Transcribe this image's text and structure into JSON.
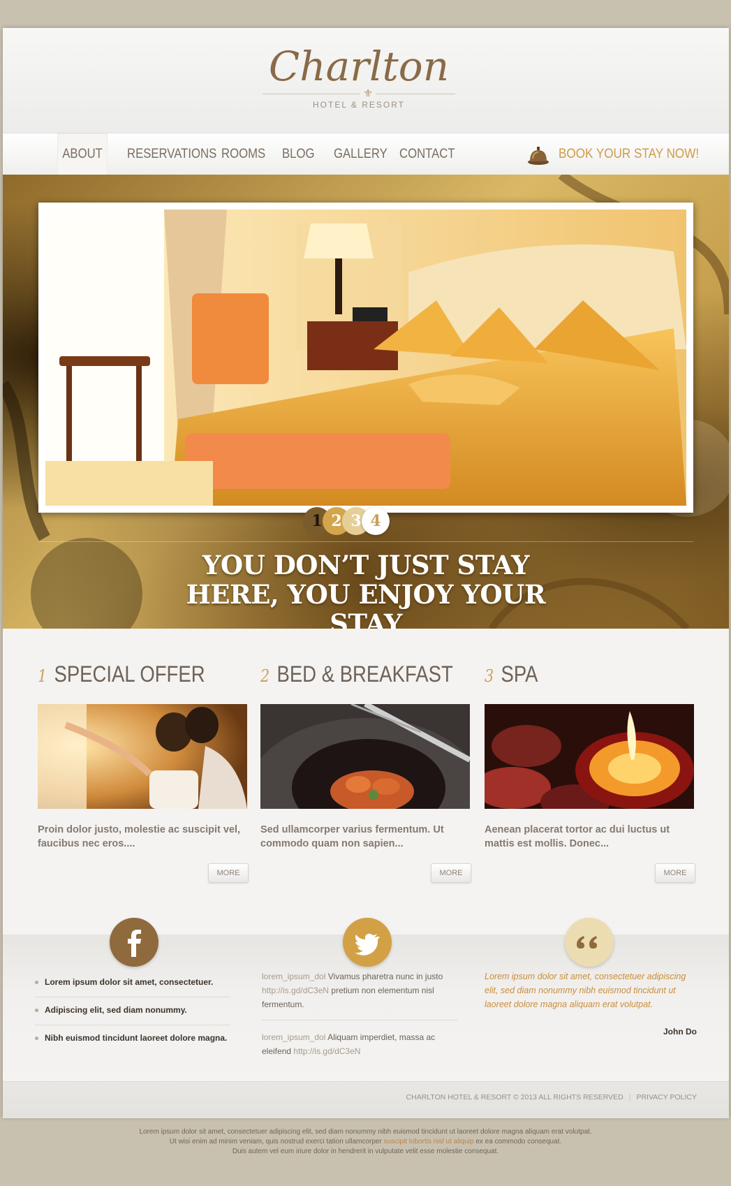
{
  "brand": {
    "name": "Charlton",
    "subtitle": "HOTEL & RESORT",
    "accent": "#d19b49",
    "brown": "#8a6a47"
  },
  "nav": {
    "items": [
      {
        "label": "ABOUT",
        "active": true
      },
      {
        "label": "RESERVATIONS"
      },
      {
        "label": "ROOMS"
      },
      {
        "label": "BLOG"
      },
      {
        "label": "GALLERY"
      },
      {
        "label": "CONTACT"
      }
    ],
    "book_label": "BOOK YOUR STAY NOW!",
    "book_icon": "bell-icon"
  },
  "hero": {
    "slides": [
      "1",
      "2",
      "3",
      "4"
    ],
    "active_slide": 1,
    "tagline_line1": "YOU DON’T JUST STAY",
    "tagline_line2": "HERE, YOU ENJOY YOUR",
    "tagline_line3": "STAY"
  },
  "features": [
    {
      "num": "1",
      "title": "SPECIAL OFFER",
      "text": "Proin dolor justo, molestie ac suscipit vel, faucibus nec eros....",
      "more": "MORE"
    },
    {
      "num": "2",
      "title": "BED & BREAKFAST",
      "text": "Sed ullamcorper varius fermentum. Ut commodo quam non sapien...",
      "more": "MORE"
    },
    {
      "num": "3",
      "title": "SPA",
      "text": "Aenean placerat tortor ac dui luctus ut mattis est mollis. Donec...",
      "more": "MORE"
    }
  ],
  "facebook": {
    "icon": "facebook-icon",
    "items": [
      "Lorem ipsum  dolor sit amet, consectetuer.",
      "Adipiscing elit, sed diam nonummy.",
      "Nibh euismod tincidunt laoreet dolore magna."
    ]
  },
  "twitter": {
    "icon": "twitter-icon",
    "tweets": [
      {
        "user": "lorem_ipsum_dol",
        "text_a": "Vivamus pharetra nunc in justo",
        "link": "http://is.gd/dC3eN",
        "text_b": "pretium non elementum nisl fermentum."
      },
      {
        "user": "lorem_ipsum_dol",
        "text_a": "Aliquam imperdiet, massa ac eleifend",
        "link": "http://is.gd/dC3eN",
        "text_b": ""
      }
    ]
  },
  "testimonial": {
    "icon": "quote-icon",
    "text": "Lorem ipsum dolor sit amet, consectetuer adipiscing elit, sed diam nonummy nibh euismod tincidunt ut laoreet dolore magna aliquam erat volutpat.",
    "author": "John Do"
  },
  "footer": {
    "copyright": "CHARLTON HOTEL & RESORT © 2013 ALL RIGHTS RESERVED",
    "separator": "|",
    "privacy": "PRIVACY POLICY"
  },
  "note": {
    "line1": "Lorem ipsum dolor sit amet, consectetuer adipiscing elit, sed diam nonummy nibh euismod tincidunt ut laoreet dolore magna aliquam erat volutpat.",
    "line2_a": "Ut wisi enim ad minim veniam, quis nostrud exerci tation ullamcorper",
    "line2_link": "suscipit lobortis nisl ut aliquip",
    "line2_b": "ex ea commodo consequat.",
    "line3": "Duis autem vel eum iriure dolor in hendrerit in vulputate velit esse molestie consequat."
  }
}
